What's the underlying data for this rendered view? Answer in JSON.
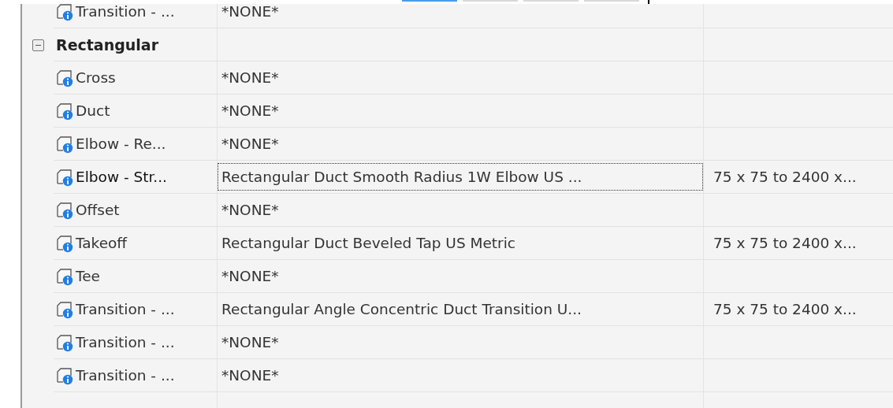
{
  "toolbar": {
    "buttons": [
      {
        "selected": true
      },
      {
        "selected": false
      },
      {
        "selected": false
      },
      {
        "selected": false
      }
    ]
  },
  "tree": [
    {
      "kind": "item",
      "name": "Transition - ...",
      "value": "*NONE*",
      "selected": false
    },
    {
      "kind": "group",
      "name": "Rectangular",
      "expanded": true,
      "children": [
        {
          "kind": "item",
          "name": "Cross",
          "value": "*NONE*",
          "selected": false
        },
        {
          "kind": "item",
          "name": "Duct",
          "value": "*NONE*",
          "selected": false
        },
        {
          "kind": "item",
          "name": "Elbow - Re...",
          "value": "*NONE*",
          "selected": false
        },
        {
          "kind": "item",
          "name": "Elbow - Str...",
          "value": "Rectangular Duct Smooth Radius 1W Elbow US ...",
          "size": "75 x 75 to 2400 x...",
          "selected": true
        },
        {
          "kind": "item",
          "name": "Offset",
          "value": "*NONE*",
          "selected": false
        },
        {
          "kind": "item",
          "name": "Takeoff",
          "value": "Rectangular Duct Beveled Tap US Metric",
          "size": "75 x 75 to 2400 x...",
          "selected": false
        },
        {
          "kind": "item",
          "name": "Tee",
          "value": "*NONE*",
          "selected": false
        },
        {
          "kind": "item",
          "name": "Transition - ...",
          "value": "Rectangular Angle Concentric Duct Transition U...",
          "size": "75 x 75 to 2400 x...",
          "selected": false
        },
        {
          "kind": "item",
          "name": "Transition - ...",
          "value": "*NONE*",
          "selected": false
        },
        {
          "kind": "item",
          "name": "Transition - ...",
          "value": "*NONE*",
          "selected": false
        }
      ]
    }
  ]
}
